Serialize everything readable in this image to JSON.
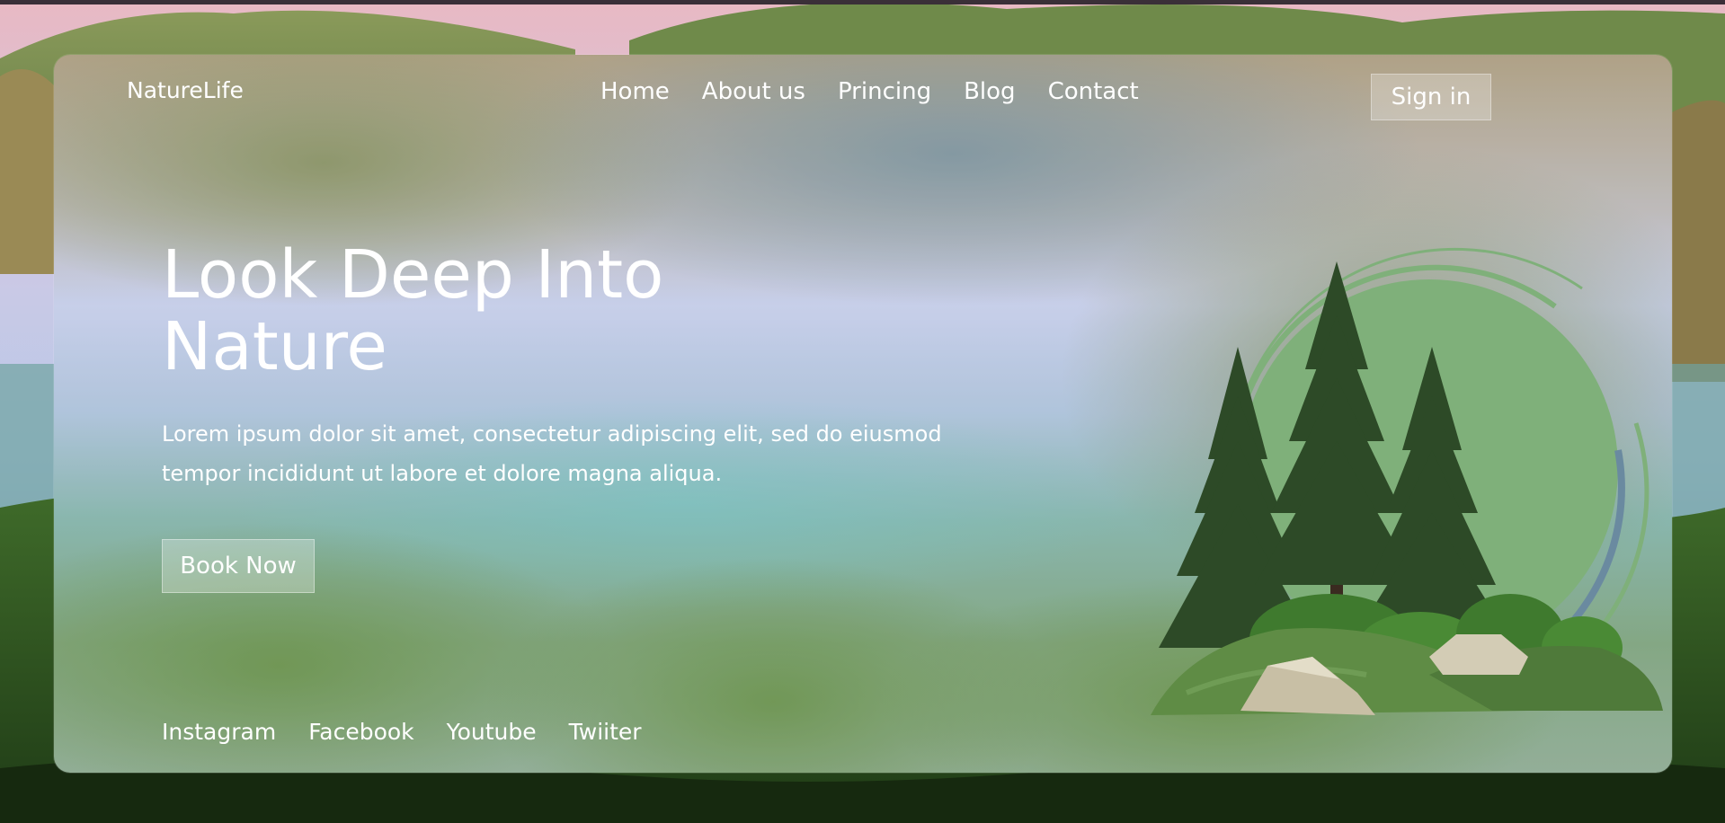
{
  "brand": {
    "name": "NatureLife"
  },
  "nav": {
    "items": [
      {
        "label": "Home"
      },
      {
        "label": "About us"
      },
      {
        "label": "Princing"
      },
      {
        "label": "Blog"
      },
      {
        "label": "Contact"
      }
    ],
    "signin_label": "Sign in"
  },
  "hero": {
    "title": "Look Deep Into Nature",
    "text": "Lorem ipsum dolor sit amet, consectetur adipiscing elit, sed do eiusmod tempor incididunt ut labore et dolore magna aliqua.",
    "cta_label": "Book Now"
  },
  "social": {
    "links": [
      {
        "label": "Instagram"
      },
      {
        "label": "Facebook"
      },
      {
        "label": "Youtube"
      },
      {
        "label": "Twiiter"
      }
    ]
  },
  "colors": {
    "text": "#ffffff",
    "illustration_green": "#7fb07a",
    "tree_dark": "#2d4a27",
    "grass": "#5f8c45"
  },
  "icons": {
    "illustration": "pine-trees-illustration"
  }
}
